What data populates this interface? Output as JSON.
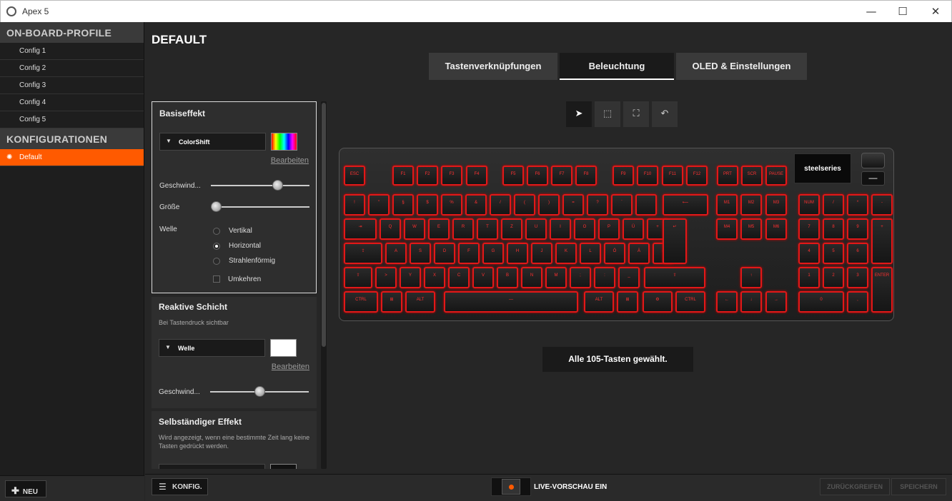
{
  "window": {
    "title": "Apex 5"
  },
  "sidebar": {
    "onboard_header": "ON-BOARD-PROFILE",
    "profiles": [
      "Config 1",
      "Config 2",
      "Config 3",
      "Config 4",
      "Config 5"
    ],
    "configs_header": "KONFIGURATIONEN",
    "configs": [
      "Default"
    ],
    "new_button": "NEU"
  },
  "main": {
    "title": "DEFAULT",
    "tabs": [
      "Tastenverknüpfungen",
      "Beleuchtung",
      "OLED & Einstellungen"
    ],
    "active_tab": "Beleuchtung"
  },
  "panel": {
    "base": {
      "title": "Basiseffekt",
      "effect": "ColorShift",
      "edit_link": "Bearbeiten",
      "speed_label": "Geschwind...",
      "speed_value": 0.7,
      "size_label": "Größe",
      "size_value": 0.0,
      "wave_label": "Welle",
      "wave_options": [
        "Vertikal",
        "Horizontal",
        "Strahlenförmig"
      ],
      "wave_selected": "Horizontal",
      "reverse_label": "Umkehren"
    },
    "reactive": {
      "title": "Reaktive Schicht",
      "subtitle": "Bei Tastendruck sichtbar",
      "effect": "Welle",
      "edit_link": "Bearbeiten",
      "speed_label": "Geschwind...",
      "speed_value": 0.5
    },
    "idle": {
      "title": "Selbständiger Effekt",
      "subtitle": "Wird angezeigt, wenn eine bestimmte Zeit lang keine Tasten gedrückt werden."
    }
  },
  "tools": [
    "pointer-icon",
    "select-area-icon",
    "select-all-icon",
    "undo-icon"
  ],
  "keyboard": {
    "brand": "steelseries",
    "key_color": "#e21818",
    "status": "Alle 105-Tasten gewählt."
  },
  "bottom": {
    "konfig_button": "KONFIG.",
    "live_preview": "LIVE-VORSCHAU EIN",
    "revert_button": "ZURÜCKGREIFEN",
    "save_button": "SPEICHERN"
  },
  "colors": {
    "accent": "#ff5a00",
    "background": "#262626"
  }
}
